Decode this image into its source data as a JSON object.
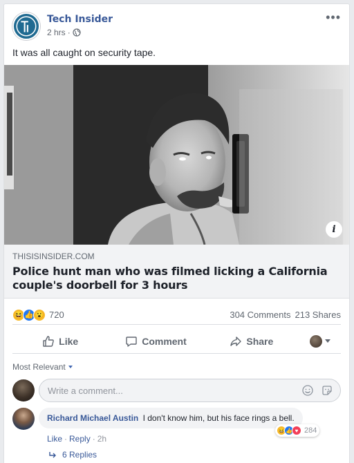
{
  "post": {
    "page_name": "Tech Insider",
    "avatar_letter": "TI",
    "time": "2 hrs",
    "separator": "·",
    "privacy_icon": "globe-icon",
    "more_icon": "ellipsis-icon",
    "text": "It was all caught on security tape."
  },
  "link": {
    "domain": "THISISINSIDER.COM",
    "title": "Police hunt man who was filmed licking a California couple's doorbell for 3 hours",
    "info_icon": "i"
  },
  "stats": {
    "reaction_count": "720",
    "reactions": [
      "haha",
      "like",
      "wow"
    ],
    "comments": "304 Comments",
    "shares": "213 Shares"
  },
  "actions": {
    "like": "Like",
    "comment": "Comment",
    "share": "Share"
  },
  "comments_section": {
    "sort_label": "Most Relevant",
    "composer_placeholder": "Write a comment..."
  },
  "comment": {
    "author": "Richard Michael Austin",
    "text": "I don't know him, but his face rings a bell.",
    "like": "Like",
    "reply": "Reply",
    "time": "2h",
    "separator": "·",
    "reaction_count": "284",
    "replies": "6 Replies"
  },
  "colors": {
    "brand_blue": "#385898",
    "avatar_blue": "#1f6a91",
    "like_blue": "#2078f4",
    "love_red": "#f33e58",
    "haha_yellow": "#f7b928"
  }
}
